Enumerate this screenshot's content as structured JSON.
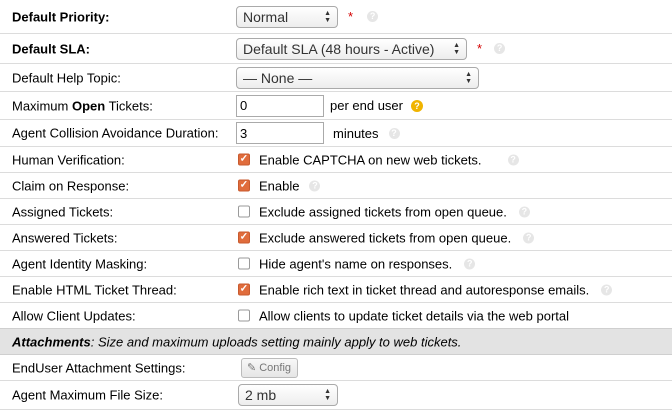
{
  "default_priority": {
    "label": "Default Priority:",
    "value": "Normal",
    "required": "*"
  },
  "default_sla": {
    "label": "Default SLA:",
    "value": "Default SLA (48 hours - Active)",
    "required": "*"
  },
  "default_help_topic": {
    "label": "Default Help Topic:",
    "value": "— None —"
  },
  "max_open_tickets": {
    "label_pre": "Maximum ",
    "label_bold": "Open",
    "label_post": " Tickets:",
    "value": "0",
    "suffix": "per end user"
  },
  "collision_duration": {
    "label": "Agent Collision Avoidance Duration:",
    "value": "3",
    "suffix": "minutes"
  },
  "checkbox_rows": [
    {
      "label": "Human Verification:",
      "text": "Enable CAPTCHA on new web tickets.",
      "checked": true
    },
    {
      "label": "Claim on Response:",
      "text": "Enable",
      "checked": true
    },
    {
      "label": "Assigned Tickets:",
      "text": "Exclude assigned tickets from open queue.",
      "checked": false
    },
    {
      "label": "Answered Tickets:",
      "text": "Exclude answered tickets from open queue.",
      "checked": true
    },
    {
      "label": "Agent Identity Masking:",
      "text": "Hide agent's name on responses.",
      "checked": false
    },
    {
      "label": "Enable HTML Ticket Thread:",
      "text": "Enable rich text in ticket thread and autoresponse emails.",
      "checked": true
    },
    {
      "label": "Allow Client Updates:",
      "text": "Allow clients to update ticket details via the web portal",
      "checked": false
    }
  ],
  "attachments_section": {
    "title": "Attachments",
    "text": ":  Size and maximum uploads setting mainly apply to web tickets."
  },
  "enduser_attachment": {
    "label": "EndUser Attachment Settings:",
    "button": "Config"
  },
  "agent_max_file_size": {
    "label": "Agent Maximum File Size:",
    "value": "2 mb"
  },
  "colors": {
    "checkbox_checked": "#e06c3c",
    "required": "#d40000",
    "warn_help": "#f0b400",
    "section_bg": "#e3e3e3"
  }
}
